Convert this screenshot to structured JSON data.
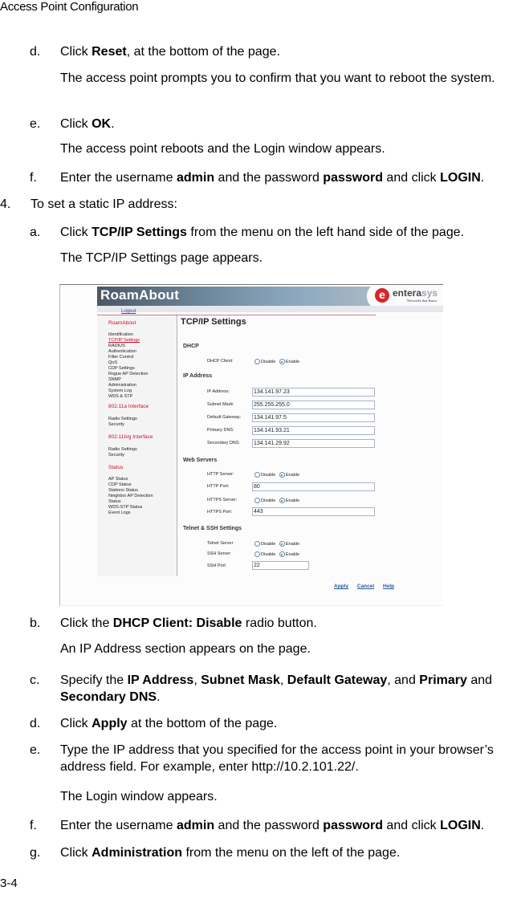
{
  "document": {
    "header": "Access Point Configuration",
    "page_number": "3-4"
  },
  "steps_top": [
    {
      "label": "d.",
      "parts": [
        "Click ",
        {
          "b": "Reset"
        },
        ", at the bottom of the page."
      ]
    },
    {
      "label": "",
      "parts": [
        "The access point prompts you to confirm that you want to reboot the system."
      ]
    },
    {
      "label": "e.",
      "parts": [
        "Click ",
        {
          "b": "OK"
        },
        "."
      ]
    },
    {
      "label": "",
      "parts": [
        "The access point reboots and the Login window appears."
      ]
    },
    {
      "label": "f.",
      "parts": [
        "Enter the username ",
        {
          "b": "admin"
        },
        " and the password ",
        {
          "b": "password"
        },
        " and click ",
        {
          "b": "LOGIN"
        },
        "."
      ]
    },
    {
      "label": "4.",
      "parts": [
        "To set a static IP address:"
      ]
    },
    {
      "label": "a.",
      "parts": [
        "Click ",
        {
          "b": "TCP/IP Settings"
        },
        " from the menu on the left hand side of the page."
      ]
    },
    {
      "label": "",
      "parts": [
        "The TCP/IP Settings page appears."
      ]
    }
  ],
  "steps_bottom": [
    {
      "label": "b.",
      "parts": [
        "Click the ",
        {
          "b": "DHCP Client: Disable"
        },
        " radio button."
      ]
    },
    {
      "label": "",
      "parts": [
        "An IP Address section appears on the page."
      ]
    },
    {
      "label": "c.",
      "parts": [
        "Specify the ",
        {
          "b": "IP Address"
        },
        ", ",
        {
          "b": "Subnet Mask"
        },
        ", ",
        {
          "b": "Default Gateway"
        },
        ", and ",
        {
          "b": "Primary"
        },
        " and ",
        {
          "b": "Secondary DNS"
        },
        "."
      ]
    },
    {
      "label": "d.",
      "parts": [
        "Click ",
        {
          "b": "Apply"
        },
        " at the bottom of the page."
      ]
    },
    {
      "label": "e.",
      "parts": [
        "Type the IP address that you specified for the access point in your browser’s address field. For example, enter http://10.2.101.22/."
      ]
    },
    {
      "label": "",
      "parts": [
        "The Login window appears."
      ]
    },
    {
      "label": "f.",
      "parts": [
        "Enter the username ",
        {
          "b": "admin"
        },
        " and the password ",
        {
          "b": "password"
        },
        " and click ",
        {
          "b": "LOGIN"
        },
        "."
      ]
    },
    {
      "label": "g.",
      "parts": [
        "Click ",
        {
          "b": "Administration"
        },
        " from the menu on the left of the page."
      ]
    }
  ],
  "screenshot": {
    "banner_title": "RoamAbout",
    "logo": {
      "brand_main": "entera",
      "brand_accent": "sys",
      "tagline": "Networks that Know",
      "mark": "e"
    },
    "logout": "Logout",
    "sidebar": {
      "sections": [
        {
          "heading": "RoamAbout",
          "items": [
            "Identification",
            "TCP/IP Settings",
            "RADIUS",
            "Authentication",
            "Filter Control",
            "QoS",
            "CDP Settings",
            "Rogue AP Detection",
            "SNMP",
            "Administration",
            "System Log",
            "WDS & STP"
          ]
        },
        {
          "heading": "802.11a Interface",
          "items": [
            "Radio Settings",
            "Security"
          ]
        },
        {
          "heading": "802.11b/g Interface",
          "items": [
            "Radio Settings",
            "Security"
          ]
        },
        {
          "heading": "Status",
          "items": [
            "AP Status",
            "CDP Status",
            "Stations Status",
            "Neighbor AP Detection Status",
            "WDS-STP Status",
            "Event Logs"
          ]
        }
      ],
      "active_item": "TCP/IP Settings"
    },
    "main": {
      "title": "TCP/IP Settings",
      "dhcp": {
        "heading": "DHCP",
        "client_label": "DHCP Client:",
        "options": [
          "Disable",
          "Enable"
        ],
        "selected": "Enable"
      },
      "ip": {
        "heading": "IP Address",
        "fields": [
          {
            "label": "IP Address:",
            "value": "134.141.97.23"
          },
          {
            "label": "Subnet Mask:",
            "value": "255.255.255.0"
          },
          {
            "label": "Default Gateway:",
            "value": "134.141.97.5"
          },
          {
            "label": "Primary DNS:",
            "value": "134.141.93.21"
          },
          {
            "label": "Secondary DNS:",
            "value": "134.141.29.92"
          }
        ]
      },
      "web": {
        "heading": "Web Servers",
        "http_server_label": "HTTP Server:",
        "http_server_selected": "Enable",
        "http_port_label": "HTTP Port:",
        "http_port": "80",
        "https_server_label": "HTTPS Server:",
        "https_server_selected": "Enable",
        "https_port_label": "HTTPS Port:",
        "https_port": "443",
        "options": [
          "Disable",
          "Enable"
        ]
      },
      "telnet_ssh": {
        "heading": "Telnet & SSH Settings",
        "telnet_label": "Telnet Server",
        "telnet_selected": "Enable",
        "ssh_label": "SSH Server",
        "ssh_selected": "Enable",
        "ssh_port_label": "SSH Port",
        "ssh_port": "22",
        "options": [
          "Disable",
          "Enable"
        ]
      },
      "footer": {
        "apply": "Apply",
        "cancel": "Cancel",
        "help": "Help"
      }
    }
  }
}
